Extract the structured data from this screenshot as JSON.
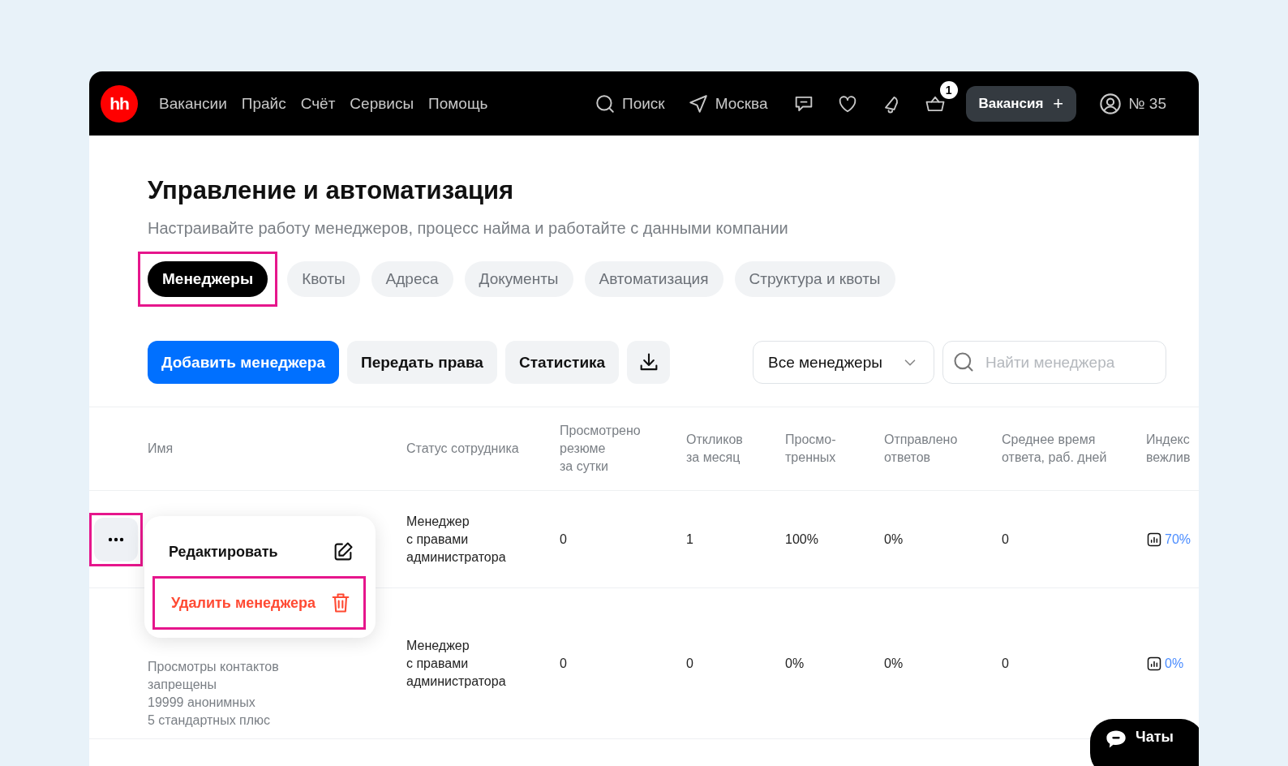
{
  "header": {
    "logo": "hh",
    "nav": [
      "Вакансии",
      "Прайс",
      "Счёт",
      "Сервисы",
      "Помощь"
    ],
    "search": "Поиск",
    "city": "Москва",
    "cart_badge": "1",
    "vacancy_button": "Вакансия",
    "plus": "+",
    "account": "№ 35"
  },
  "title": "Управление и автоматизация",
  "subtitle": "Настраивайте работу менеджеров, процесс найма и работайте с данными компании",
  "tabs": [
    {
      "label": "Менеджеры",
      "selected": true,
      "highlighted": true
    },
    {
      "label": "Квоты",
      "selected": false,
      "highlighted": false
    },
    {
      "label": "Адреса",
      "selected": false,
      "highlighted": false
    },
    {
      "label": "Документы",
      "selected": false,
      "highlighted": false
    },
    {
      "label": "Автоматизация",
      "selected": false,
      "highlighted": false
    },
    {
      "label": "Структура и квоты",
      "selected": false,
      "highlighted": false
    }
  ],
  "toolbar": {
    "buttons": [
      {
        "label": "Добавить менеджера",
        "kind": "primary"
      },
      {
        "label": "Передать права",
        "kind": "secondary"
      },
      {
        "label": "Статистика",
        "kind": "secondary"
      }
    ],
    "filter": "Все менеджеры",
    "search_placeholder": "Найти менеджера"
  },
  "table": {
    "columns": [
      "Имя",
      "Статус сотрудника",
      "Просмотрено\nрезюме\nза сутки",
      "Откликов\nза месяц",
      "Просмо-\nтренных",
      "Отправлено\nответов",
      "Среднее время\nответа, раб. дней",
      "Индекс\nвежлив"
    ],
    "rows": [
      {
        "menu_button_highlighted": true,
        "cells": [
          "",
          "Менеджер\nс правами\nадминистратора",
          "0",
          "1",
          "100%",
          "0%",
          "0",
          "70%"
        ]
      },
      {
        "menu_button_highlighted": false,
        "cells": [
          "Просмотры контактов\nзапрещены\n19999 анонимных\n5 стандартных плюс",
          "Менеджер\nс правами\nадминистратора",
          "0",
          "0",
          "0%",
          "0%",
          "0",
          "0%"
        ]
      }
    ]
  },
  "row_menu": {
    "items": [
      {
        "label": "Редактировать",
        "kind": "edit",
        "highlighted": false
      },
      {
        "label": "Удалить менеджера",
        "kind": "delete",
        "highlighted": true
      }
    ]
  },
  "chat_button": "Чаты"
}
